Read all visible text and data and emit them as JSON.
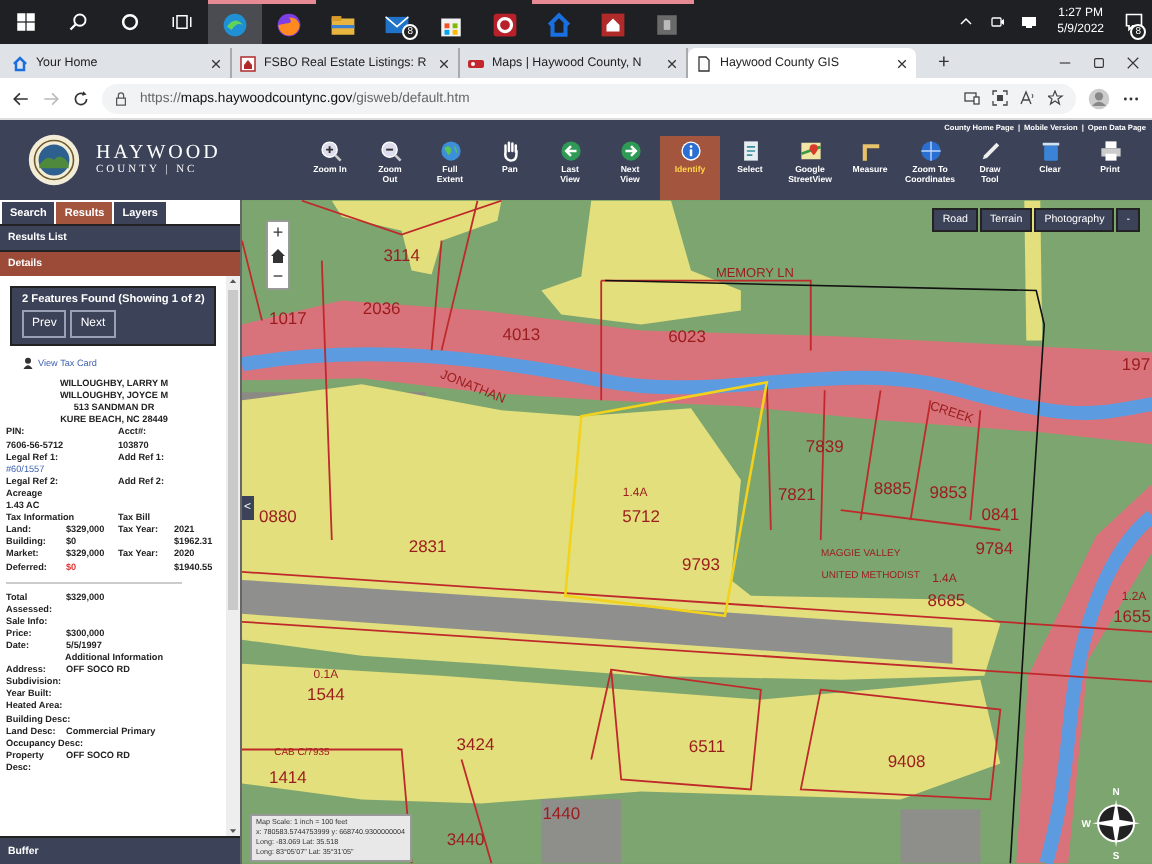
{
  "taskbar": {
    "apps": [
      {
        "running": true,
        "selected": true
      },
      {
        "running": true,
        "selected": false
      },
      {
        "running": false,
        "selected": false
      },
      {
        "running": false,
        "selected": false,
        "badge": "8"
      },
      {
        "running": false,
        "selected": false
      },
      {
        "running": false,
        "selected": false
      },
      {
        "running": true,
        "selected": false
      },
      {
        "running": true,
        "selected": false
      },
      {
        "running": true,
        "selected": false
      }
    ],
    "time": "1:27 PM",
    "date": "5/9/2022",
    "notification_badge": "8"
  },
  "browser": {
    "tabs": [
      {
        "label": "Your Home",
        "selected": false
      },
      {
        "label": "FSBO Real Estate Listings: R",
        "selected": false
      },
      {
        "label": "Maps | Haywood County, N",
        "selected": false
      },
      {
        "label": "Haywood County GIS",
        "selected": true
      }
    ],
    "new_tab": "+",
    "url": {
      "scheme": "https://",
      "host": "maps.haywoodcountync.gov",
      "path": "/gisweb/default.htm"
    },
    "forward_disabled": true
  },
  "app": {
    "logo": {
      "title": "HAYWOOD",
      "subtitle": "COUNTY | NC"
    },
    "links": [
      "County Home Page",
      "Mobile Version",
      "Open Data Page"
    ],
    "link_separator": "|",
    "tools": [
      {
        "label": "Zoom In",
        "selected": false
      },
      {
        "label": "Zoom Out",
        "selected": false
      },
      {
        "label": "Full Extent",
        "selected": false
      },
      {
        "label": "Pan",
        "selected": false
      },
      {
        "label": "Last View",
        "selected": false
      },
      {
        "label": "Next View",
        "selected": false
      },
      {
        "label": "Identify",
        "selected": true
      },
      {
        "label": "Select",
        "selected": false
      },
      {
        "label": "Google StreetView",
        "selected": false
      },
      {
        "label": "Measure",
        "selected": false
      },
      {
        "label": "Zoom To Coordinates",
        "selected": false
      },
      {
        "label": "Draw Tool",
        "selected": false
      },
      {
        "label": "Clear",
        "selected": false
      },
      {
        "label": "Print",
        "selected": false
      }
    ]
  },
  "panel": {
    "tabs": [
      {
        "label": "Search",
        "selected": false
      },
      {
        "label": "Results",
        "selected": true
      },
      {
        "label": "Layers",
        "selected": false
      }
    ],
    "results_header": "Results List",
    "details_header": "Details",
    "summary": "2 Features Found (Showing 1 of 2)",
    "buttons": [
      "Prev",
      "Next"
    ],
    "tax_card_link": "View Tax Card",
    "rows": [
      {
        "kind": "center",
        "cells": [
          {
            "text": "WILLOUGHBY, LARRY M"
          }
        ]
      },
      {
        "kind": "center",
        "cells": [
          {
            "text": "WILLOUGHBY, JOYCE M"
          }
        ]
      },
      {
        "kind": "center",
        "cells": [
          {
            "text": "513 SANDMAN DR"
          }
        ]
      },
      {
        "kind": "center",
        "cells": [
          {
            "text": "KURE BEACH, NC 28449"
          }
        ]
      },
      {
        "kind": "two",
        "cells": [
          {
            "text": "PIN:"
          },
          {
            "text": "Acct#:"
          }
        ]
      },
      {
        "kind": "two",
        "cells": [
          {
            "text": "7606-56-5712"
          },
          {
            "text": "103870"
          }
        ]
      },
      {
        "kind": "two",
        "cells": [
          {
            "text": "Legal Ref 1:"
          },
          {
            "text": "Add Ref 1:"
          }
        ]
      },
      {
        "kind": "one",
        "cells": [
          {
            "text": "#60/1557",
            "link": true
          }
        ]
      },
      {
        "kind": "two",
        "cells": [
          {
            "text": "Legal Ref 2:"
          },
          {
            "text": "Add Ref 2:"
          }
        ]
      },
      {
        "kind": "one",
        "cells": [
          {
            "text": "Acreage"
          }
        ]
      },
      {
        "kind": "one",
        "cells": [
          {
            "text": "1.43 AC"
          }
        ]
      },
      {
        "kind": "two",
        "cells": [
          {
            "text": "Tax Information"
          },
          {
            "text": "Tax Bill"
          }
        ]
      },
      {
        "kind": "four",
        "cells": [
          {
            "text": "Land:"
          },
          {
            "text": "$329,000"
          },
          {
            "text": "Tax Year:"
          },
          {
            "text": "2021"
          }
        ]
      },
      {
        "kind": "three",
        "cells": [
          {
            "text": "Building:"
          },
          {
            "text": "$0"
          },
          {
            "text": "$1962.31"
          }
        ]
      },
      {
        "kind": "four",
        "cells": [
          {
            "text": "Market:"
          },
          {
            "text": "$329,000"
          },
          {
            "text": "Tax Year:"
          },
          {
            "text": "2020"
          }
        ]
      },
      {
        "kind": "three",
        "cells": [
          {
            "text": "Deferred:"
          },
          {
            "text": "$0",
            "alert": true
          },
          {
            "text": "$1940.55"
          }
        ]
      },
      {
        "kind": "rule",
        "cells": []
      },
      {
        "kind": "pair",
        "cells": [
          {
            "text": "Total Assessed:"
          },
          {
            "text": "$329,000"
          }
        ]
      },
      {
        "kind": "one",
        "cells": [
          {
            "text": "Sale Info:"
          }
        ]
      },
      {
        "kind": "pair",
        "cells": [
          {
            "text": "Price:"
          },
          {
            "text": "$300,000"
          }
        ]
      },
      {
        "kind": "pair",
        "cells": [
          {
            "text": "Date:"
          },
          {
            "text": "5/5/1997"
          }
        ]
      },
      {
        "kind": "center",
        "cells": [
          {
            "text": "Additional Information"
          }
        ]
      },
      {
        "kind": "pair",
        "cells": [
          {
            "text": "Address:"
          },
          {
            "text": "OFF SOCO RD"
          }
        ]
      },
      {
        "kind": "one",
        "cells": [
          {
            "text": "Subdivision:"
          }
        ]
      },
      {
        "kind": "one",
        "cells": [
          {
            "text": "Year Built:"
          }
        ]
      },
      {
        "kind": "one",
        "cells": [
          {
            "text": "Heated Area:"
          }
        ]
      },
      {
        "kind": "one",
        "cells": [
          {
            "text": "Building Desc:"
          }
        ]
      },
      {
        "kind": "pair",
        "cells": [
          {
            "text": "Land Desc:"
          },
          {
            "text": "Commercial Primary"
          }
        ]
      },
      {
        "kind": "one",
        "cells": [
          {
            "text": "Occupancy Desc:"
          }
        ]
      },
      {
        "kind": "pair",
        "cells": [
          {
            "text": "Property Desc:"
          },
          {
            "text": "OFF SOCO RD"
          }
        ]
      }
    ],
    "footer": "Buffer"
  },
  "map": {
    "basemaps": [
      "Road",
      "Terrain",
      "Photography"
    ],
    "collapse": "-",
    "zoom_in": "+",
    "zoom_out": "−",
    "panel_toggle": "<",
    "labels": [
      {
        "text": "3114",
        "kind": "parcel"
      },
      {
        "text": "MEMORY LN",
        "kind": "street"
      },
      {
        "text": "1017",
        "kind": "parcel"
      },
      {
        "text": "2036",
        "kind": "parcel"
      },
      {
        "text": "4013",
        "kind": "parcel"
      },
      {
        "text": "6023",
        "kind": "parcel"
      },
      {
        "text": "197",
        "kind": "parcel"
      },
      {
        "text": "JONATHAN",
        "kind": "street"
      },
      {
        "text": "CREEK",
        "kind": "street"
      },
      {
        "text": "7839",
        "kind": "parcel"
      },
      {
        "text": "1.4A",
        "kind": "area"
      },
      {
        "text": "7821",
        "kind": "parcel"
      },
      {
        "text": "8885",
        "kind": "parcel"
      },
      {
        "text": "9853",
        "kind": "parcel"
      },
      {
        "text": "0880",
        "kind": "parcel"
      },
      {
        "text": "5712",
        "kind": "parcel"
      },
      {
        "text": "0841",
        "kind": "parcel"
      },
      {
        "text": "2831",
        "kind": "parcel"
      },
      {
        "text": "MAGGIE VALLEY",
        "kind": "owner"
      },
      {
        "text": "9784",
        "kind": "parcel"
      },
      {
        "text": "9793",
        "kind": "parcel"
      },
      {
        "text": "UNITED METHODIST",
        "kind": "owner"
      },
      {
        "text": "1.4A",
        "kind": "area"
      },
      {
        "text": "8685",
        "kind": "parcel"
      },
      {
        "text": "1.2A",
        "kind": "area"
      },
      {
        "text": "1655",
        "kind": "parcel"
      },
      {
        "text": "0.1A",
        "kind": "area"
      },
      {
        "text": "1544",
        "kind": "parcel"
      },
      {
        "text": "CAB C/7935",
        "kind": "owner"
      },
      {
        "text": "3424",
        "kind": "parcel"
      },
      {
        "text": "6511",
        "kind": "parcel"
      },
      {
        "text": "9408",
        "kind": "parcel"
      },
      {
        "text": "1414",
        "kind": "parcel"
      },
      {
        "text": "1440",
        "kind": "parcel"
      },
      {
        "text": "3440",
        "kind": "parcel"
      }
    ],
    "scale_box": [
      "Map Scale: 1 inch = 100 feet",
      "x: 780583.5744753999 y: 668740.9300000004",
      "Long: -83.069 Lat: 35.518",
      "Long: 83°05'07\" Lat: 35°31'05\""
    ],
    "compass": [
      "N",
      "W",
      "S"
    ]
  }
}
